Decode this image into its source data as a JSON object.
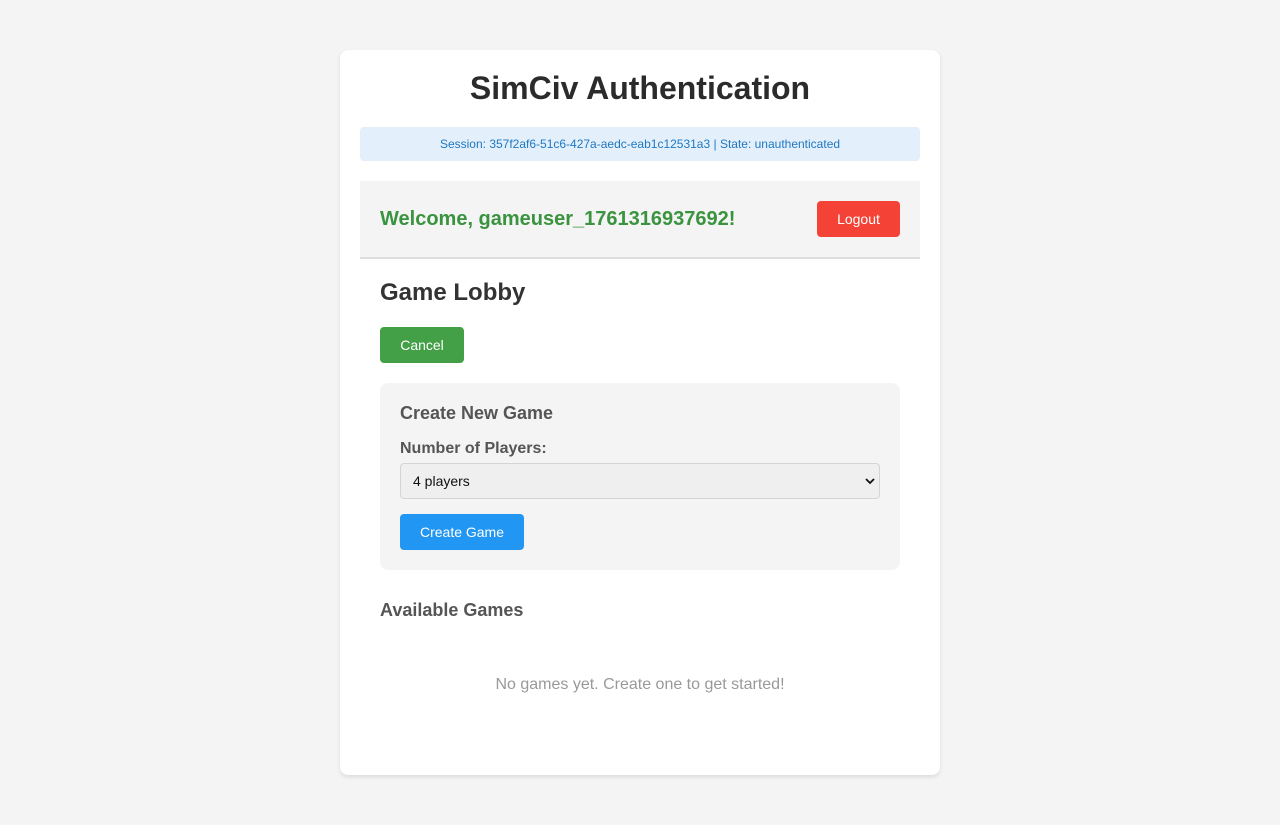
{
  "app": {
    "title": "SimCiv Authentication"
  },
  "session": {
    "text": "Session: 357f2af6-51c6-427a-aedc-eab1c12531a3 | State: unauthenticated"
  },
  "user": {
    "welcome": "Welcome, gameuser_1761316937692!",
    "logout_label": "Logout"
  },
  "lobby": {
    "title": "Game Lobby",
    "cancel_label": "Cancel",
    "create": {
      "title": "Create New Game",
      "players_label": "Number of Players:",
      "players_selected": "4 players",
      "create_label": "Create Game"
    },
    "available": {
      "title": "Available Games",
      "empty_message": "No games yet. Create one to get started!"
    }
  },
  "colors": {
    "background": "#f4f4f4",
    "session_bg": "#e3f0fb",
    "session_text": "#1f77c2",
    "welcome_text": "#3a933f",
    "logout": "#f44336",
    "cancel": "#43a047",
    "create": "#2196f3"
  },
  "icons": {
    "select_arrow": "chevron-down-icon"
  }
}
